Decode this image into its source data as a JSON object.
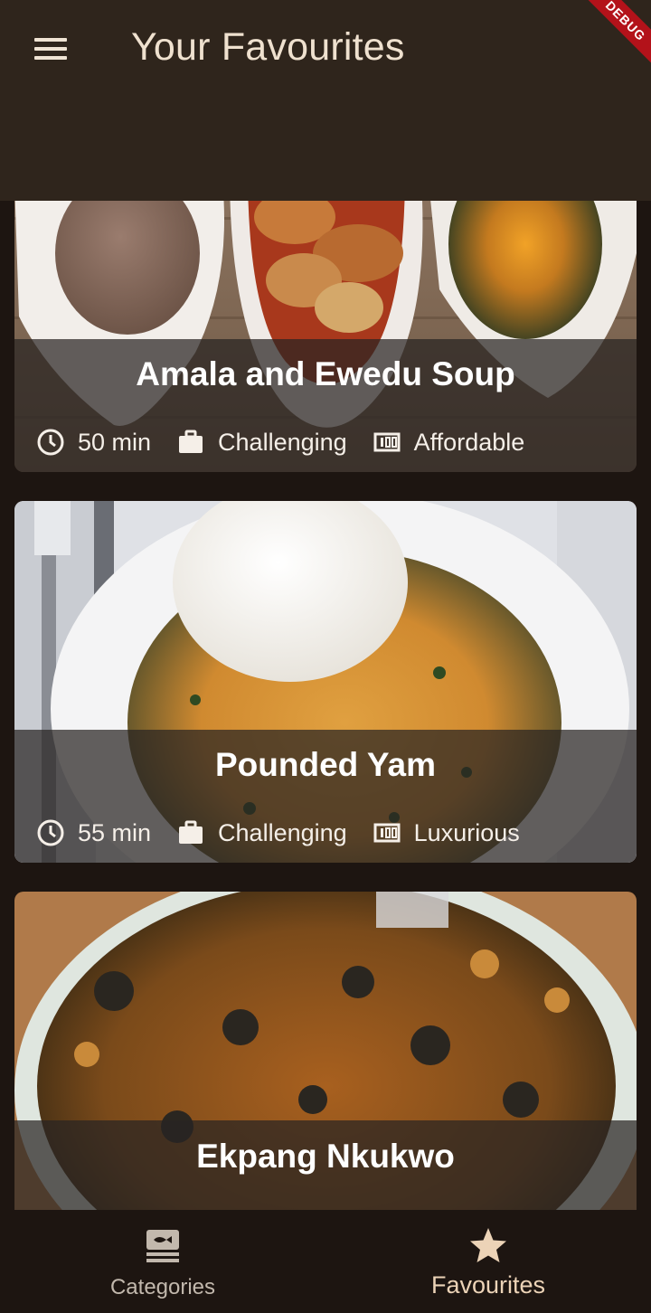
{
  "appbar": {
    "title": "Your Favourites",
    "menu_icon": "menu-icon"
  },
  "debug_banner": "DEBUG",
  "meals": [
    {
      "title": "Amala and Ewedu Soup",
      "duration": "50 min",
      "complexity": "Challenging",
      "affordability": "Affordable"
    },
    {
      "title": "Pounded Yam",
      "duration": "55 min",
      "complexity": "Challenging",
      "affordability": "Luxurious"
    },
    {
      "title": "Ekpang Nkukwo"
    }
  ],
  "bottom_nav": {
    "categories_label": "Categories",
    "favourites_label": "Favourites"
  },
  "colors": {
    "appbar": "#2f251c",
    "background": "#1d1511",
    "title": "#efe1cf",
    "nav_selected": "#ecd3b7"
  }
}
